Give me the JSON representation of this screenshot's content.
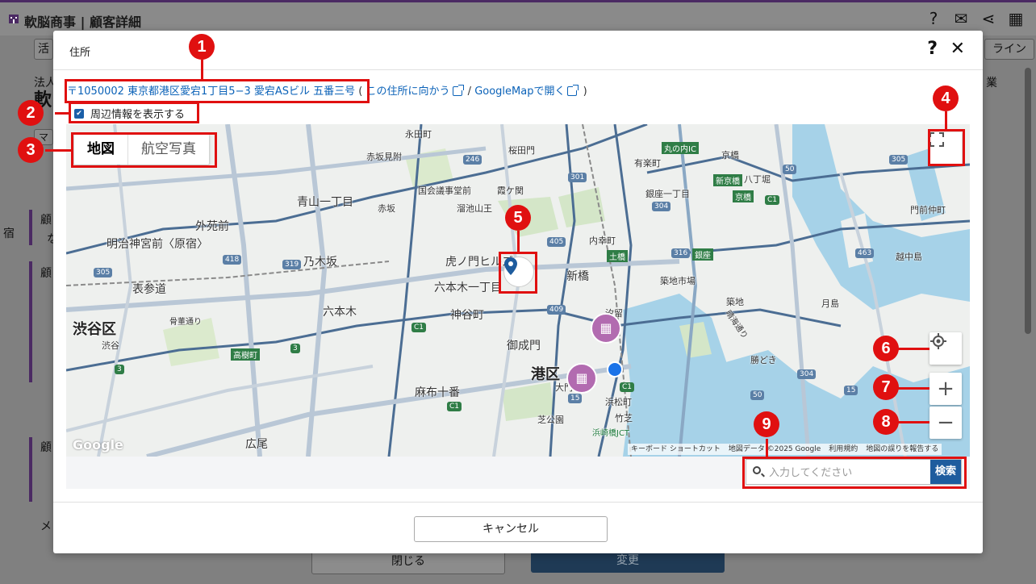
{
  "app": {
    "title": "軟脳商事 | 顧客詳細",
    "header_icons": [
      "help-icon",
      "mail-icon",
      "share-icon",
      "qr-code-icon"
    ],
    "bg_tab_partial": "活",
    "bg_right_button_partial": "ライン",
    "bg_label_partial": "法人",
    "bg_label_right_partial": "業",
    "bg_big_partial": "軟",
    "bg_close_label": "閉じる",
    "bg_change_label": "変更",
    "bg_left_fragments": [
      "な",
      "顧",
      "顧",
      "顧",
      "メ",
      "マ",
      "1",
      "宿"
    ]
  },
  "modal": {
    "title": "住所",
    "address_link": "〒1050002 東京都港区愛宕1丁目5−3 愛宕ASビル 五番三号",
    "paren_open": "(",
    "route_link": "この住所に向かう",
    "separator": "/",
    "googlemap_link": "GoogleMapで開く",
    "paren_close": ")",
    "show_surroundings_label": "周辺情報を表示する",
    "show_surroundings_checked": true,
    "map_type_map": "地図",
    "map_type_aerial": "航空写真",
    "map_footer": {
      "shortcuts": "キーボード ショートカット",
      "map_data": "地図データ ©2025 Google",
      "terms": "利用規約",
      "report": "地図の誤りを報告する"
    },
    "google_logo": "Google",
    "search_placeholder": "入力してください",
    "search_button": "検索",
    "cancel_button": "キャンセル"
  },
  "map_labels": {
    "districts": [
      "渋谷区",
      "港区"
    ],
    "places": [
      "永田町",
      "桜田門",
      "赤坂見附",
      "国会議事堂前",
      "霞ケ関",
      "溜池山王",
      "赤坂",
      "青山一丁目",
      "外苑前",
      "明治神宮前〈原宿〉",
      "乃木坂",
      "表参道",
      "六本木",
      "六本木一丁目",
      "虎ノ門ヒルズ",
      "神谷町",
      "御成門",
      "麻布十番",
      "芝公園",
      "広尾",
      "新橋",
      "内幸町",
      "汐留",
      "浜松町",
      "竹芝",
      "浜崎橋JCT",
      "築地市場",
      "築地",
      "勝どき",
      "月島",
      "越中島",
      "八丁堀",
      "京橋",
      "有楽町",
      "銀座一丁目",
      "丸の内IC",
      "門前仲町",
      "渋谷",
      "骨董通り",
      "高樹町",
      "大門",
      "土橋",
      "銀座",
      "新京橋",
      "京橋",
      "晴海通り"
    ],
    "route_shields": [
      "246",
      "301",
      "405",
      "319",
      "418",
      "305",
      "409",
      "304",
      "316",
      "463",
      "304",
      "50",
      "15",
      "C1",
      "50",
      "3",
      "3",
      "C1",
      "C1",
      "15",
      "C1",
      "305"
    ]
  },
  "annotations": [
    "1",
    "2",
    "3",
    "4",
    "5",
    "6",
    "7",
    "8",
    "9"
  ],
  "colors": {
    "accent": "#1e5c9e",
    "annotation": "#e01010",
    "link": "#0b62b8",
    "water": "#a6d2e8"
  }
}
